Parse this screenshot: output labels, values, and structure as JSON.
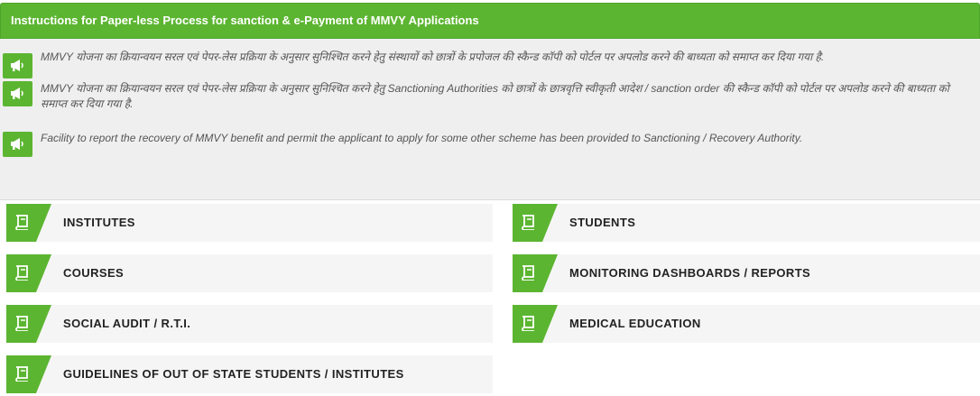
{
  "panel": {
    "title": "Instructions for Paper-less Process for sanction & e-Payment of MMVY Applications",
    "notices": [
      {
        "icon": "megaphone-icon",
        "text": "MMVY योजना का क्रियान्वयन सरल एवं पेपर-लेस प्रक्रिया के अनुसार सुनिश्चित करने हेतु संस्थायों को छात्रों के प्रपोजल की स्कैन्ड कॉपी को पोर्टल पर अपलोड करने की बाध्यता को समाप्त कर दिया गया है."
      },
      {
        "icon": "megaphone-icon",
        "text": "MMVY योजना का क्रियान्वयन सरल एवं पेपर-लेस प्रक्रिया के अनुसार सुनिश्चित करने हेतु Sanctioning Authorities को छात्रों के छात्रवृत्ति स्वीकृती आदेश / sanction order की स्कैन्ड कॉपी को पोर्टल पर अपलोड करने की बाध्यता को समाप्त कर दिया गया है."
      },
      {
        "icon": "megaphone-icon",
        "text": "Facility to report the recovery of MMVY benefit and permit the applicant to apply for some other scheme has been provided to Sanctioning / Recovery Authority."
      }
    ]
  },
  "colors": {
    "accent": "#5cb531",
    "tile_bg": "#f5f5f5",
    "panel_bg": "#efefef"
  },
  "tiles": [
    {
      "icon": "book-icon",
      "label": "INSTITUTES"
    },
    {
      "icon": "book-icon",
      "label": "STUDENTS"
    },
    {
      "icon": "book-icon",
      "label": "COURSES"
    },
    {
      "icon": "book-icon",
      "label": "MONITORING DASHBOARDS / REPORTS"
    },
    {
      "icon": "book-icon",
      "label": "SOCIAL AUDIT / R.T.I."
    },
    {
      "icon": "book-icon",
      "label": "MEDICAL EDUCATION"
    },
    {
      "icon": "book-icon",
      "label": "GUIDELINES OF OUT OF STATE STUDENTS / INSTITUTES"
    }
  ]
}
